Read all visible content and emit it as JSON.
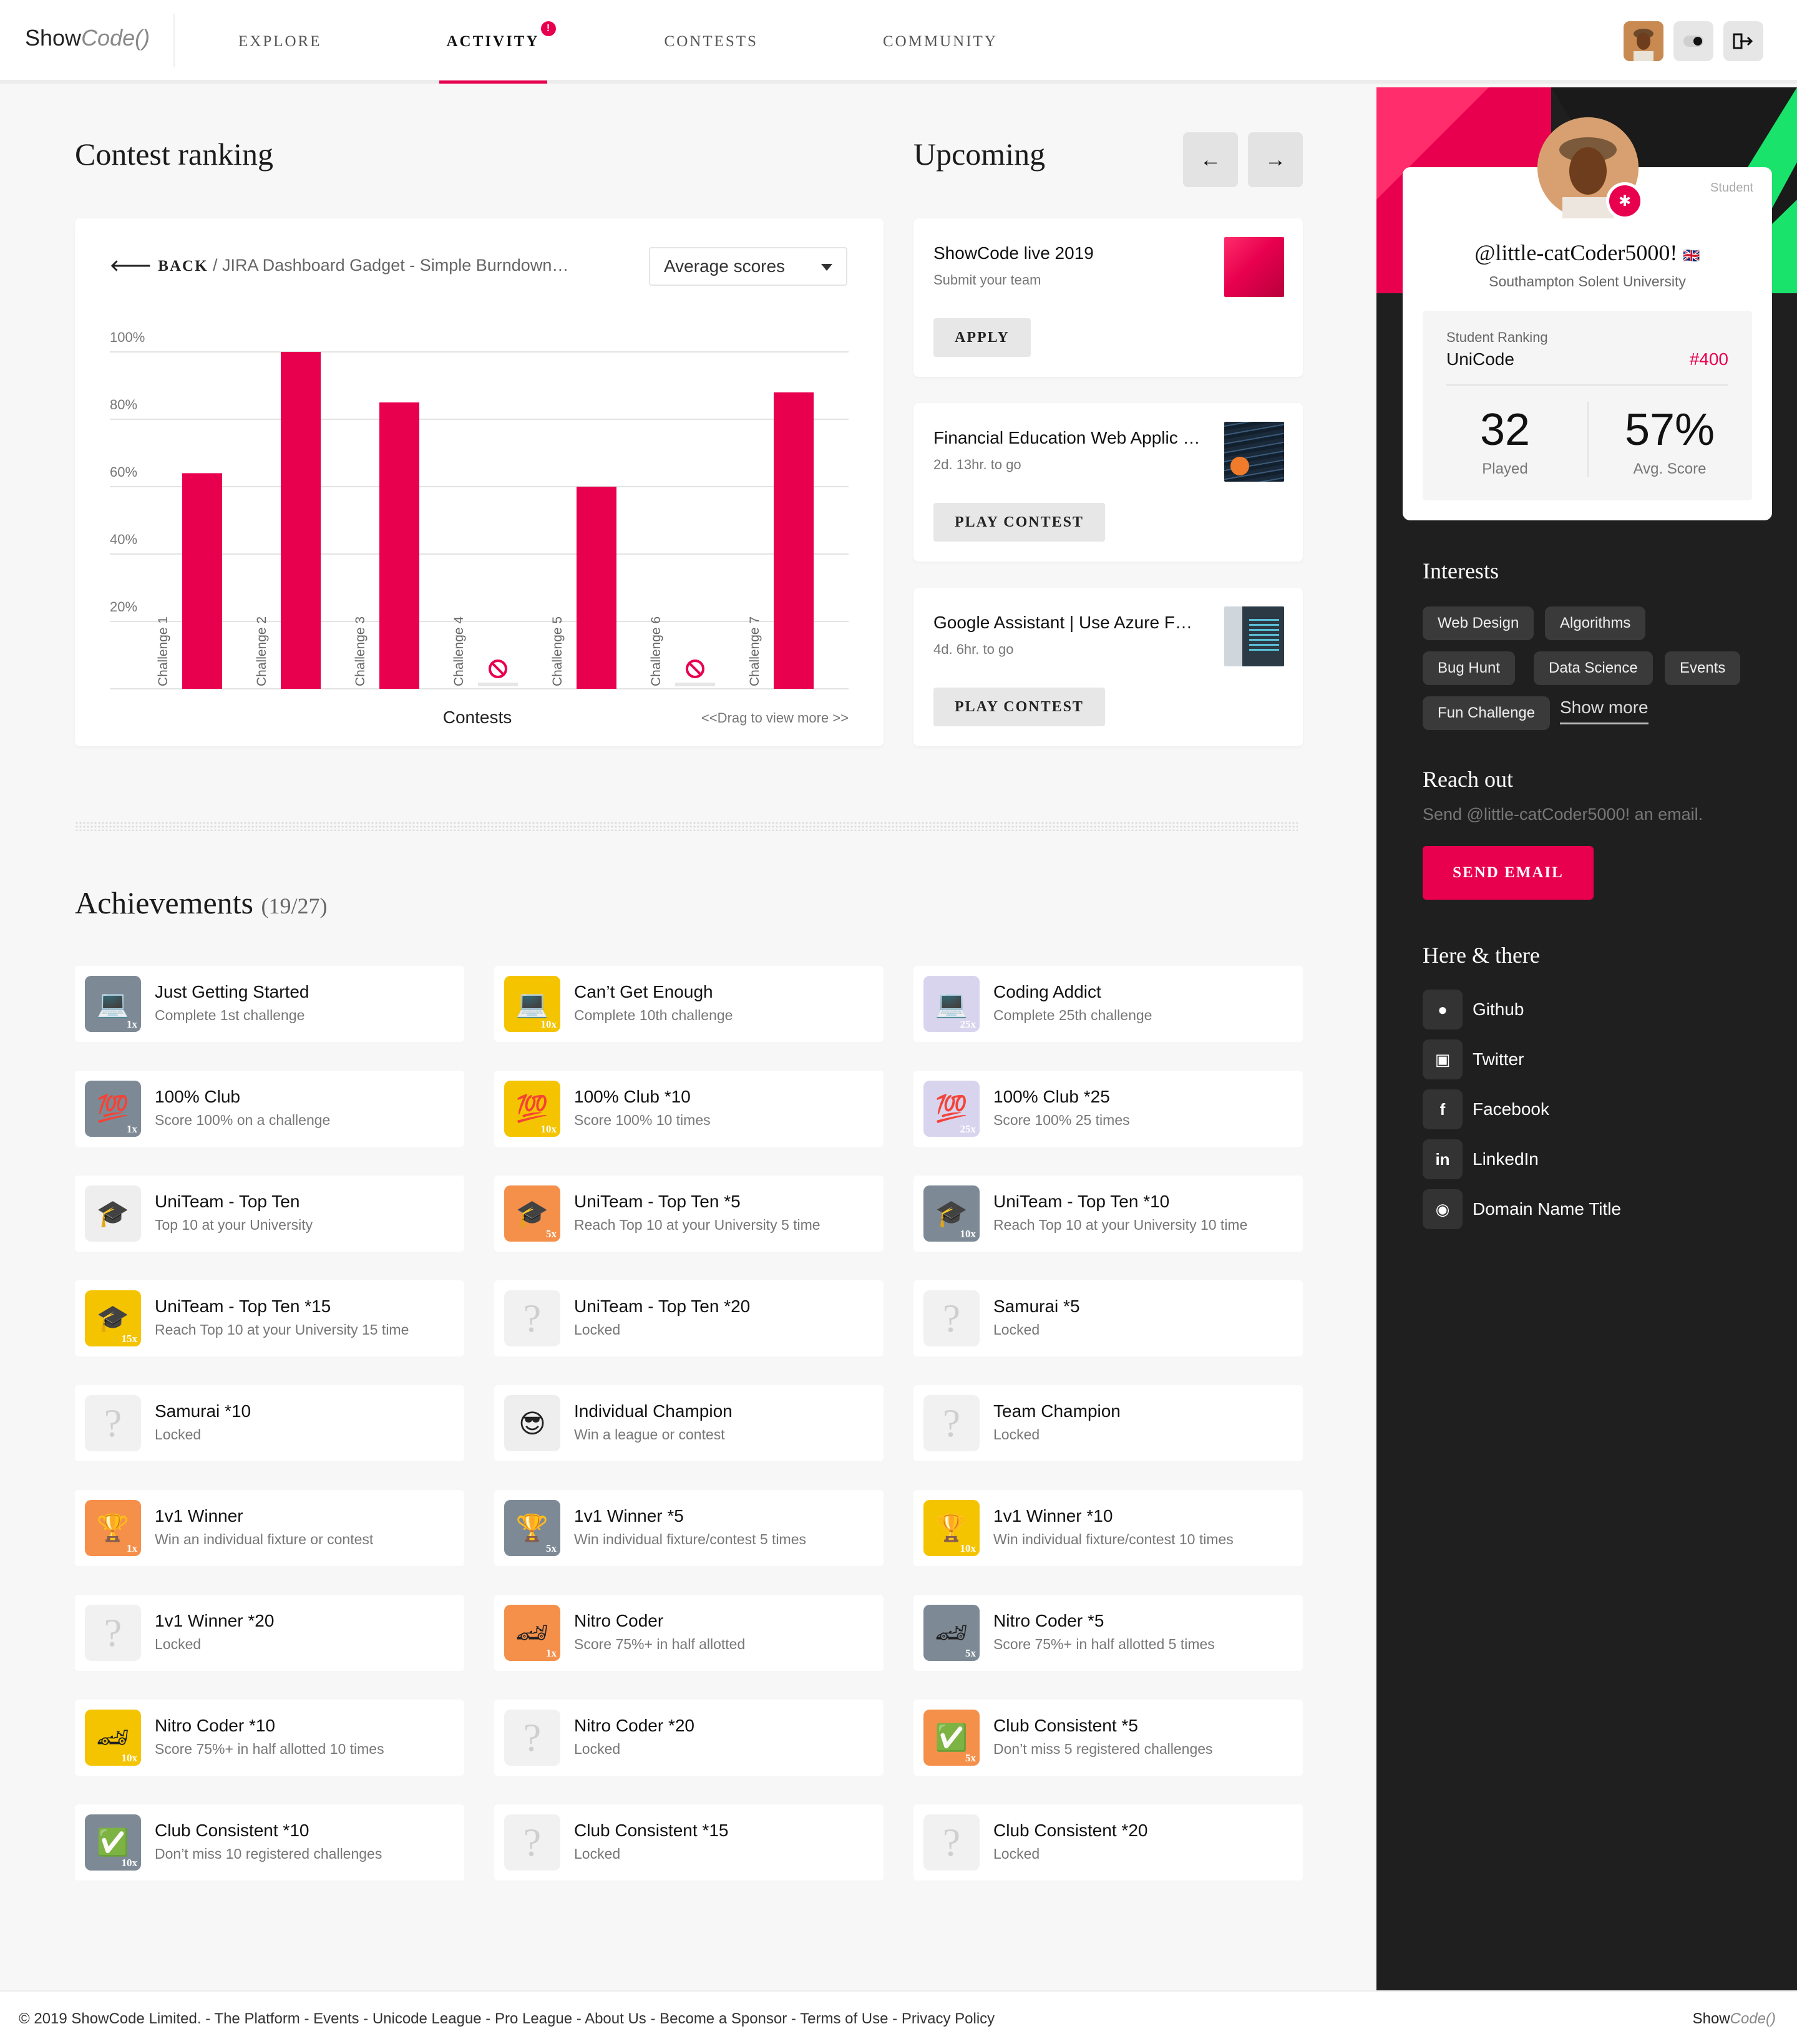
{
  "header": {
    "logo_main": "Show",
    "logo_code": "Code()",
    "nav": [
      {
        "label": "EXPLORE"
      },
      {
        "label": "ACTIVITY",
        "badge": "!"
      },
      {
        "label": "CONTESTS"
      },
      {
        "label": "COMMUNITY"
      }
    ]
  },
  "ranking": {
    "title": "Contest ranking",
    "back_label": "BACK",
    "breadcrumb": "/ JIRA Dashboard Gadget - Simple Burndown…",
    "select_value": "Average scores",
    "x_axis_label": "Contests",
    "drag_hint": "<<Drag to view more >>"
  },
  "chart_data": {
    "type": "bar",
    "categories": [
      "Challenge 1",
      "Challenge 2",
      "Challenge 3",
      "Challenge 4",
      "Challenge 5",
      "Challenge 6",
      "Challenge 7"
    ],
    "values": [
      64,
      100,
      85,
      null,
      60,
      null,
      88
    ],
    "ylim": [
      0,
      100
    ],
    "yticks": [
      "20%",
      "40%",
      "60%",
      "80%",
      "100%"
    ],
    "color": "#e8004f",
    "grid": true
  },
  "upcoming": {
    "title": "Upcoming",
    "items": [
      {
        "title": "ShowCode live 2019",
        "subtitle": "Submit your team",
        "button": "APPLY"
      },
      {
        "title": "Financial Education Web Applic …",
        "subtitle": "2d. 13hr. to go",
        "button": "PLAY CONTEST"
      },
      {
        "title": "Google Assistant | Use Azure F…",
        "subtitle": "4d. 6hr. to go",
        "button": "PLAY CONTEST"
      }
    ]
  },
  "achievements": {
    "title": "Achievements",
    "count": "(19/27)",
    "items": [
      {
        "title": "Just Getting Started",
        "desc": "Complete 1st challenge",
        "mult": "1x",
        "icon": "laptop-icon",
        "bg": "#7d8a96"
      },
      {
        "title": "Can’t Get Enough",
        "desc": "Complete 10th challenge",
        "mult": "10x",
        "icon": "laptop-icon",
        "bg": "#f5c400"
      },
      {
        "title": "Coding Addict",
        "desc": "Complete 25th challenge",
        "mult": "25x",
        "icon": "laptop-icon",
        "bg": "#d9d4ee"
      },
      {
        "title": "100% Club",
        "desc": "Score 100% on a challenge",
        "mult": "1x",
        "icon": "hundred-icon",
        "bg": "#7d8a96"
      },
      {
        "title": "100% Club *10",
        "desc": "Score 100% 10 times",
        "mult": "10x",
        "icon": "hundred-icon",
        "bg": "#f5c400"
      },
      {
        "title": "100% Club *25",
        "desc": "Score 100% 25 times",
        "mult": "25x",
        "icon": "hundred-icon",
        "bg": "#d9d4ee"
      },
      {
        "title": "UniTeam - Top Ten",
        "desc": "Top 10 at your University",
        "mult": "",
        "icon": "graduate-icon",
        "bg": "#eeeeee"
      },
      {
        "title": "UniTeam - Top Ten *5",
        "desc": "Reach Top 10 at your University 5 time",
        "mult": "5x",
        "icon": "graduate-icon",
        "bg": "#f5904a"
      },
      {
        "title": "UniTeam - Top Ten *10",
        "desc": "Reach Top 10 at your University 10 time",
        "mult": "10x",
        "icon": "graduate-icon",
        "bg": "#7d8a96"
      },
      {
        "title": "UniTeam - Top Ten *15",
        "desc": "Reach Top 10 at your University 15 time",
        "mult": "15x",
        "icon": "graduate-icon",
        "bg": "#f5c400"
      },
      {
        "title": "UniTeam - Top Ten *20",
        "desc": "Locked",
        "mult": "",
        "icon": "locked-icon",
        "bg": "#f1f1f1"
      },
      {
        "title": "Samurai *5",
        "desc": "Locked",
        "mult": "",
        "icon": "locked-icon",
        "bg": "#f1f1f1"
      },
      {
        "title": "Samurai *10",
        "desc": "Locked",
        "mult": "",
        "icon": "locked-icon",
        "bg": "#f1f1f1"
      },
      {
        "title": "Individual Champion",
        "desc": "Win a league or contest",
        "mult": "",
        "icon": "champion-icon",
        "bg": "#eeeeee"
      },
      {
        "title": "Team Champion",
        "desc": "Locked",
        "mult": "",
        "icon": "locked-icon",
        "bg": "#f1f1f1"
      },
      {
        "title": "1v1 Winner",
        "desc": "Win an individual fixture or contest",
        "mult": "1x",
        "icon": "trophy-icon",
        "bg": "#f5904a"
      },
      {
        "title": "1v1 Winner *5",
        "desc": "Win individual fixture/contest 5 times",
        "mult": "5x",
        "icon": "trophy-icon",
        "bg": "#7d8a96"
      },
      {
        "title": "1v1 Winner *10",
        "desc": "Win individual fixture/contest 10 times",
        "mult": "10x",
        "icon": "trophy-icon",
        "bg": "#f5c400"
      },
      {
        "title": "1v1 Winner *20",
        "desc": "Locked",
        "mult": "",
        "icon": "locked-icon",
        "bg": "#f1f1f1"
      },
      {
        "title": "Nitro Coder",
        "desc": "Score 75%+ in half allotted",
        "mult": "1x",
        "icon": "race-car-icon",
        "bg": "#f5904a"
      },
      {
        "title": "Nitro Coder *5",
        "desc": "Score 75%+ in half allotted 5 times",
        "mult": "5x",
        "icon": "race-car-icon",
        "bg": "#7d8a96"
      },
      {
        "title": "Nitro Coder *10",
        "desc": "Score 75%+ in half allotted 10 times",
        "mult": "10x",
        "icon": "race-car-icon",
        "bg": "#f5c400"
      },
      {
        "title": "Nitro Coder *20",
        "desc": "Locked",
        "mult": "",
        "icon": "locked-icon",
        "bg": "#f1f1f1"
      },
      {
        "title": "Club Consistent *5",
        "desc": "Don’t miss 5 registered challenges",
        "mult": "5x",
        "icon": "calendar-check-icon",
        "bg": "#f5904a"
      },
      {
        "title": "Club Consistent *10",
        "desc": "Don’t miss 10 registered challenges",
        "mult": "10x",
        "icon": "calendar-check-icon",
        "bg": "#7d8a96"
      },
      {
        "title": "Club Consistent *15",
        "desc": "Locked",
        "mult": "",
        "icon": "locked-icon",
        "bg": "#f1f1f1"
      },
      {
        "title": "Club Consistent *20",
        "desc": "Locked",
        "mult": "",
        "icon": "locked-icon",
        "bg": "#f1f1f1"
      }
    ]
  },
  "profile": {
    "role": "Student",
    "handle": "@little-catCoder5000!",
    "flag": "🇬🇧",
    "university": "Southampton Solent University",
    "ranking_label": "Student Ranking",
    "ranking_name": "UniCode",
    "ranking_value": "#400",
    "played": "32",
    "played_label": "Played",
    "avg_score": "57%",
    "avg_score_label": "Avg. Score"
  },
  "interests": {
    "title": "Interests",
    "chips": [
      "Web Design",
      "Algorithms",
      "Bug Hunt",
      "Data Science",
      "Events",
      "Fun Challenge"
    ],
    "show_more": "Show more"
  },
  "reach_out": {
    "title": "Reach out",
    "subtitle": "Send @little-catCoder5000! an email.",
    "button": "SEND EMAIL"
  },
  "here_there": {
    "title": "Here & there",
    "links": [
      {
        "label": "Github",
        "icon": "github-icon"
      },
      {
        "label": "Twitter",
        "icon": "twitter-icon"
      },
      {
        "label": "Facebook",
        "icon": "facebook-icon"
      },
      {
        "label": "LinkedIn",
        "icon": "linkedin-icon"
      },
      {
        "label": "Domain Name Title",
        "icon": "chat-bubble-icon"
      }
    ]
  },
  "footer": {
    "links": "© 2019 ShowCode Limited. - The Platform - Events - Unicode League - Pro League - About Us - Become a Sponsor - Terms of Use - Privacy Policy",
    "logo_main": "Show",
    "logo_code": "Code()"
  },
  "colors": {
    "accent": "#e8004f",
    "accent_green": "#19e36b",
    "sidebar_bg": "#1f1f1f"
  }
}
